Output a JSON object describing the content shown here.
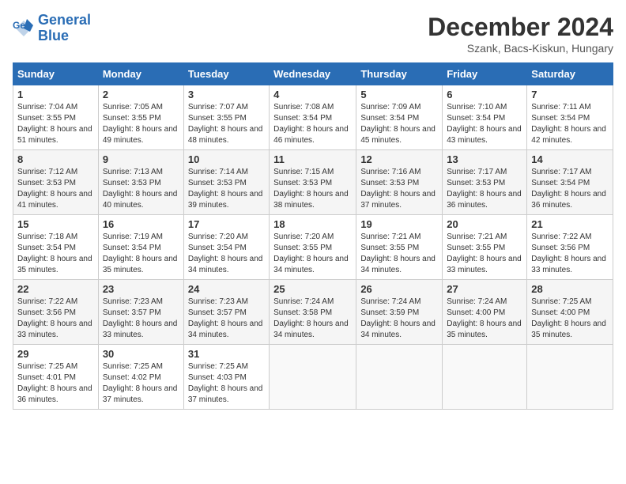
{
  "header": {
    "logo_line1": "General",
    "logo_line2": "Blue",
    "month_title": "December 2024",
    "location": "Szank, Bacs-Kiskun, Hungary"
  },
  "weekdays": [
    "Sunday",
    "Monday",
    "Tuesday",
    "Wednesday",
    "Thursday",
    "Friday",
    "Saturday"
  ],
  "weeks": [
    [
      {
        "day": "1",
        "sunrise": "7:04 AM",
        "sunset": "3:55 PM",
        "daylight": "8 hours and 51 minutes."
      },
      {
        "day": "2",
        "sunrise": "7:05 AM",
        "sunset": "3:55 PM",
        "daylight": "8 hours and 49 minutes."
      },
      {
        "day": "3",
        "sunrise": "7:07 AM",
        "sunset": "3:55 PM",
        "daylight": "8 hours and 48 minutes."
      },
      {
        "day": "4",
        "sunrise": "7:08 AM",
        "sunset": "3:54 PM",
        "daylight": "8 hours and 46 minutes."
      },
      {
        "day": "5",
        "sunrise": "7:09 AM",
        "sunset": "3:54 PM",
        "daylight": "8 hours and 45 minutes."
      },
      {
        "day": "6",
        "sunrise": "7:10 AM",
        "sunset": "3:54 PM",
        "daylight": "8 hours and 43 minutes."
      },
      {
        "day": "7",
        "sunrise": "7:11 AM",
        "sunset": "3:54 PM",
        "daylight": "8 hours and 42 minutes."
      }
    ],
    [
      {
        "day": "8",
        "sunrise": "7:12 AM",
        "sunset": "3:53 PM",
        "daylight": "8 hours and 41 minutes."
      },
      {
        "day": "9",
        "sunrise": "7:13 AM",
        "sunset": "3:53 PM",
        "daylight": "8 hours and 40 minutes."
      },
      {
        "day": "10",
        "sunrise": "7:14 AM",
        "sunset": "3:53 PM",
        "daylight": "8 hours and 39 minutes."
      },
      {
        "day": "11",
        "sunrise": "7:15 AM",
        "sunset": "3:53 PM",
        "daylight": "8 hours and 38 minutes."
      },
      {
        "day": "12",
        "sunrise": "7:16 AM",
        "sunset": "3:53 PM",
        "daylight": "8 hours and 37 minutes."
      },
      {
        "day": "13",
        "sunrise": "7:17 AM",
        "sunset": "3:53 PM",
        "daylight": "8 hours and 36 minutes."
      },
      {
        "day": "14",
        "sunrise": "7:17 AM",
        "sunset": "3:54 PM",
        "daylight": "8 hours and 36 minutes."
      }
    ],
    [
      {
        "day": "15",
        "sunrise": "7:18 AM",
        "sunset": "3:54 PM",
        "daylight": "8 hours and 35 minutes."
      },
      {
        "day": "16",
        "sunrise": "7:19 AM",
        "sunset": "3:54 PM",
        "daylight": "8 hours and 35 minutes."
      },
      {
        "day": "17",
        "sunrise": "7:20 AM",
        "sunset": "3:54 PM",
        "daylight": "8 hours and 34 minutes."
      },
      {
        "day": "18",
        "sunrise": "7:20 AM",
        "sunset": "3:55 PM",
        "daylight": "8 hours and 34 minutes."
      },
      {
        "day": "19",
        "sunrise": "7:21 AM",
        "sunset": "3:55 PM",
        "daylight": "8 hours and 34 minutes."
      },
      {
        "day": "20",
        "sunrise": "7:21 AM",
        "sunset": "3:55 PM",
        "daylight": "8 hours and 33 minutes."
      },
      {
        "day": "21",
        "sunrise": "7:22 AM",
        "sunset": "3:56 PM",
        "daylight": "8 hours and 33 minutes."
      }
    ],
    [
      {
        "day": "22",
        "sunrise": "7:22 AM",
        "sunset": "3:56 PM",
        "daylight": "8 hours and 33 minutes."
      },
      {
        "day": "23",
        "sunrise": "7:23 AM",
        "sunset": "3:57 PM",
        "daylight": "8 hours and 33 minutes."
      },
      {
        "day": "24",
        "sunrise": "7:23 AM",
        "sunset": "3:57 PM",
        "daylight": "8 hours and 34 minutes."
      },
      {
        "day": "25",
        "sunrise": "7:24 AM",
        "sunset": "3:58 PM",
        "daylight": "8 hours and 34 minutes."
      },
      {
        "day": "26",
        "sunrise": "7:24 AM",
        "sunset": "3:59 PM",
        "daylight": "8 hours and 34 minutes."
      },
      {
        "day": "27",
        "sunrise": "7:24 AM",
        "sunset": "4:00 PM",
        "daylight": "8 hours and 35 minutes."
      },
      {
        "day": "28",
        "sunrise": "7:25 AM",
        "sunset": "4:00 PM",
        "daylight": "8 hours and 35 minutes."
      }
    ],
    [
      {
        "day": "29",
        "sunrise": "7:25 AM",
        "sunset": "4:01 PM",
        "daylight": "8 hours and 36 minutes."
      },
      {
        "day": "30",
        "sunrise": "7:25 AM",
        "sunset": "4:02 PM",
        "daylight": "8 hours and 37 minutes."
      },
      {
        "day": "31",
        "sunrise": "7:25 AM",
        "sunset": "4:03 PM",
        "daylight": "8 hours and 37 minutes."
      },
      null,
      null,
      null,
      null
    ]
  ]
}
